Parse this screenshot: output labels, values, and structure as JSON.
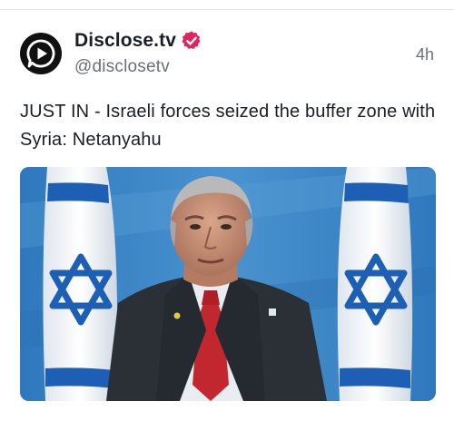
{
  "post": {
    "author": {
      "display_name": "Disclose.tv",
      "handle": "@disclosetv",
      "verified": true,
      "avatar_icon": "play-bubble-icon"
    },
    "timestamp": "4h",
    "text": "JUST IN - Israeli forces seized the buffer zone with Syria: Netanyahu",
    "media": {
      "type": "photo",
      "description_icon": "speaker-with-flags-image"
    }
  },
  "colors": {
    "verified_badge": "#e0245e",
    "flag_blue": "#1d5fb5",
    "backdrop_blue": "#3f86c6"
  }
}
